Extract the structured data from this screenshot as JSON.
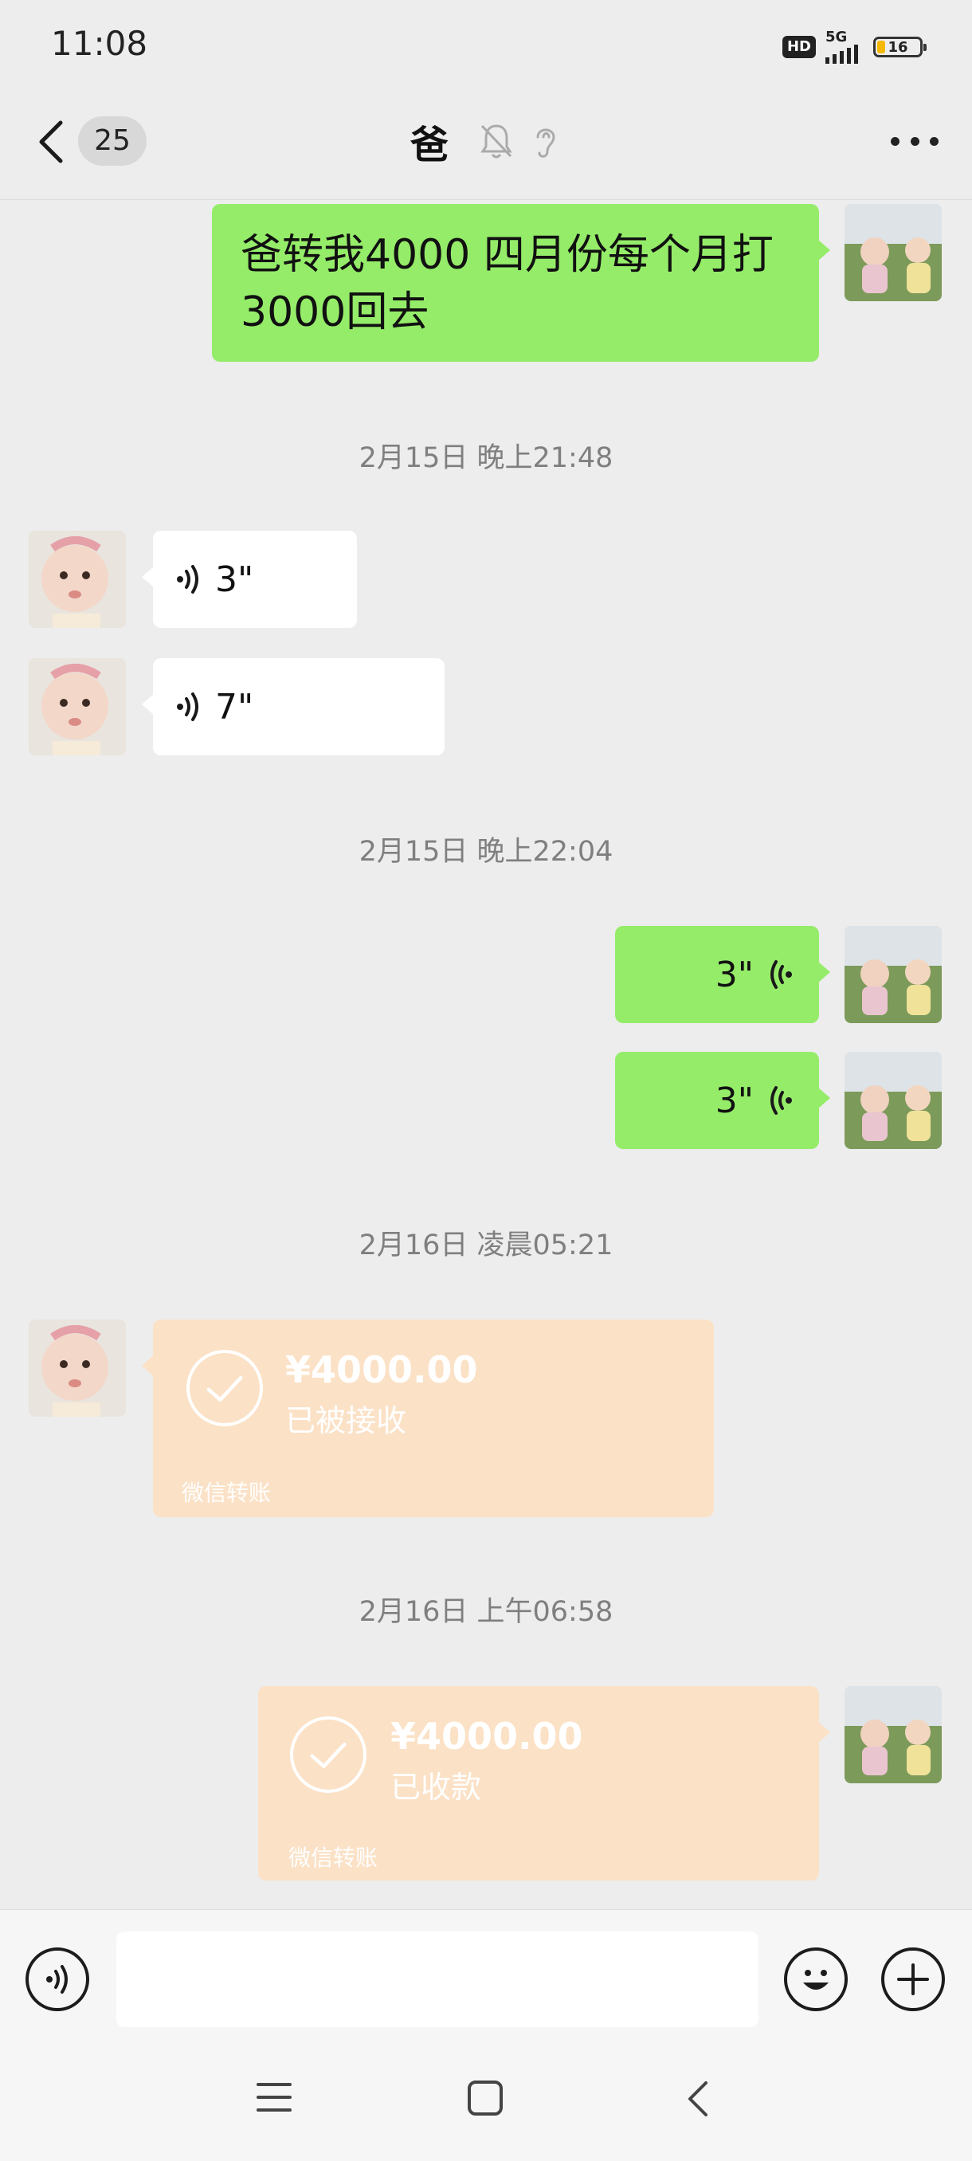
{
  "status_bar": {
    "time": "11:08",
    "hd": "HD",
    "network": "5G",
    "battery": "16"
  },
  "header": {
    "unread_count": "25",
    "title": "爸"
  },
  "messages": {
    "m1_text": "爸转我4000  四月份每个月打3000回去",
    "ts1": "2月15日 晚上21:48",
    "voice1": "3\"",
    "voice2": "7\"",
    "ts2": "2月15日 晚上22:04",
    "voice3": "3\"",
    "voice4": "3\"",
    "ts3": "2月16日 凌晨05:21",
    "transfer1": {
      "amount": "¥4000.00",
      "status": "已被接收",
      "footer": "微信转账"
    },
    "ts4": "2月16日 上午06:58",
    "transfer2": {
      "amount": "¥4000.00",
      "status": "已收款",
      "footer": "微信转账"
    }
  },
  "input": {
    "placeholder": ""
  },
  "colors": {
    "sent_bubble": "#95ec69",
    "received_bubble": "#ffffff",
    "transfer_bubble": "#fbe1c6",
    "background": "#ededed"
  },
  "icons": [
    "back-arrow-icon",
    "mute-bell-icon",
    "earpiece-icon",
    "more-icon",
    "voice-icon",
    "check-icon",
    "voice-input-icon",
    "emoji-icon",
    "plus-icon",
    "menu-icon",
    "home-icon",
    "back-nav-icon"
  ]
}
